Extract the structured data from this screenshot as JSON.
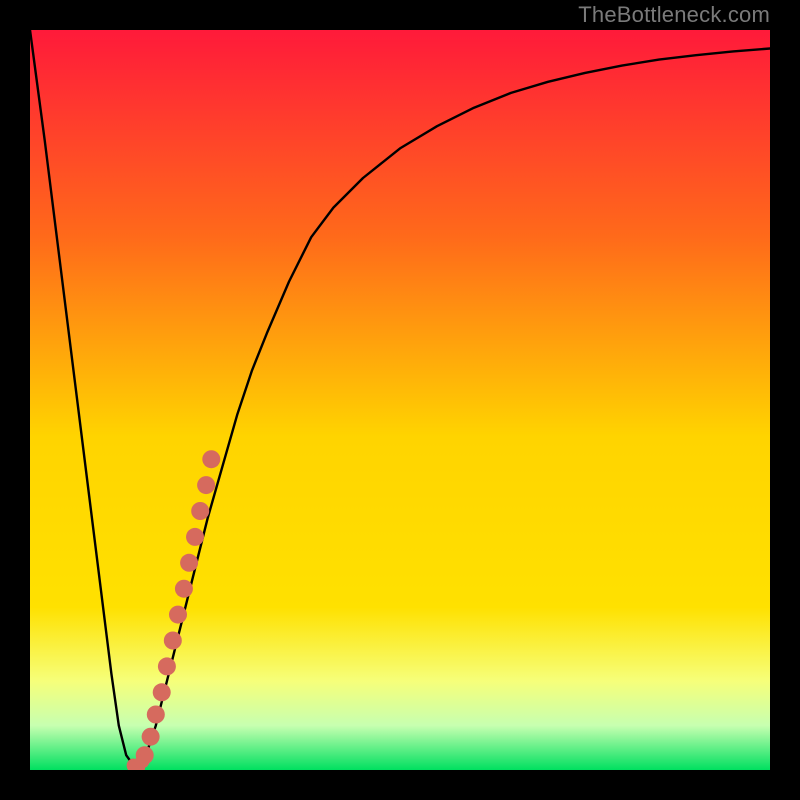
{
  "watermark": "TheBottleneck.com",
  "colors": {
    "frame": "#000000",
    "curve": "#000000",
    "marker": "#d66a5e",
    "grad_top": "#ff1a3a",
    "grad_mid1": "#ff8a00",
    "grad_mid2": "#ffe100",
    "grad_band": "#f6ff7a",
    "grad_soft": "#c7ffb0",
    "grad_bottom": "#00e060"
  },
  "chart_data": {
    "type": "line",
    "title": "",
    "xlabel": "",
    "ylabel": "",
    "xlim": [
      0,
      100
    ],
    "ylim": [
      0,
      100
    ],
    "curve": {
      "x": [
        0,
        2,
        4,
        6,
        8,
        10,
        11,
        12,
        13,
        14,
        15,
        16,
        17,
        18,
        19,
        20,
        22,
        24,
        26,
        28,
        30,
        32,
        35,
        38,
        41,
        45,
        50,
        55,
        60,
        65,
        70,
        75,
        80,
        85,
        90,
        95,
        100
      ],
      "y": [
        100,
        85,
        69,
        53,
        37,
        21,
        13,
        6,
        2,
        0.6,
        1,
        3,
        6,
        10,
        14,
        18,
        26,
        34,
        41,
        48,
        54,
        59,
        66,
        72,
        76,
        80,
        84,
        87,
        89.5,
        91.5,
        93,
        94.2,
        95.2,
        96,
        96.6,
        97.1,
        97.5
      ]
    },
    "markers": {
      "x": [
        15.5,
        16.3,
        17.0,
        17.8,
        18.5,
        19.3,
        20.0,
        20.8,
        21.5,
        22.3,
        23.0,
        23.8,
        24.5
      ],
      "y": [
        2.0,
        4.5,
        7.5,
        10.5,
        14.0,
        17.5,
        21.0,
        24.5,
        28.0,
        31.5,
        35.0,
        38.5,
        42.0
      ]
    },
    "hook": {
      "x": [
        14.0,
        14.6,
        15.2
      ],
      "y": [
        0.6,
        0.3,
        1.2
      ]
    }
  }
}
